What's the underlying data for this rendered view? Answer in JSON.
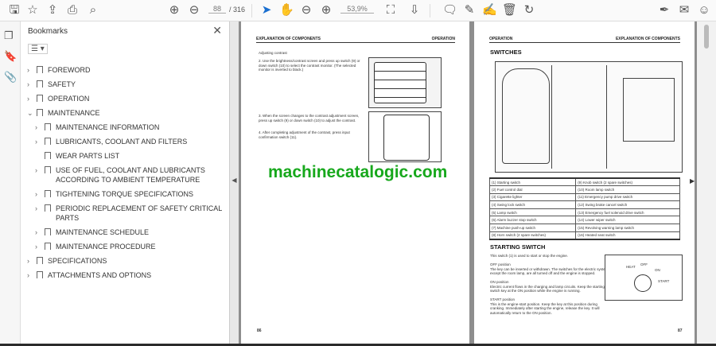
{
  "toolbar": {
    "current_page": "88",
    "total_pages": "/ 316",
    "zoom": "53,9%",
    "icons": [
      "save-icon",
      "star-icon",
      "upload-icon",
      "print-icon",
      "search-icon",
      "page-up-icon",
      "page-down-icon",
      "select-arrow-icon",
      "hand-icon",
      "zoom-out-icon",
      "zoom-in-icon",
      "fit-page-icon",
      "scroll-mode-icon",
      "comment-icon",
      "pen-icon",
      "sign-icon",
      "trash-icon",
      "rotate-icon",
      "fill-sign-icon",
      "mail-icon",
      "account-icon"
    ]
  },
  "sidebar": {
    "title": "Bookmarks",
    "items": [
      {
        "label": "FOREWORD",
        "level": 0,
        "expand": true
      },
      {
        "label": "SAFETY",
        "level": 0,
        "expand": true
      },
      {
        "label": "OPERATION",
        "level": 0,
        "expand": true
      },
      {
        "label": "MAINTENANCE",
        "level": 0,
        "expand": "open"
      },
      {
        "label": "MAINTENANCE INFORMATION",
        "level": 1,
        "expand": true
      },
      {
        "label": "LUBRICANTS, COOLANT AND FILTERS",
        "level": 1,
        "expand": true
      },
      {
        "label": "WEAR PARTS LIST",
        "level": 1,
        "expand": false
      },
      {
        "label": "USE OF FUEL, COOLANT AND LUBRICANTS ACCORDING TO AMBIENT TEMPERATURE",
        "level": 1,
        "expand": true
      },
      {
        "label": "TIGHTENING TORQUE SPECIFICATIONS",
        "level": 1,
        "expand": true
      },
      {
        "label": "PERIODIC REPLACEMENT OF SAFETY CRITICAL PARTS",
        "level": 1,
        "expand": true
      },
      {
        "label": "MAINTENANCE SCHEDULE",
        "level": 1,
        "expand": true
      },
      {
        "label": "MAINTENANCE PROCEDURE",
        "level": 1,
        "expand": true
      },
      {
        "label": "SPECIFICATIONS",
        "level": 0,
        "expand": true
      },
      {
        "label": "ATTACHMENTS AND OPTIONS",
        "level": 0,
        "expand": true
      }
    ]
  },
  "left_page": {
    "header_left": "EXPLANATION OF COMPONENTS",
    "header_right": "OPERATION",
    "bullet": "Adjusting contrast",
    "step2": "2.  Use the brightness/contrast screen and press up switch (9) or down switch (10) to select the contrast monitor. (The selected monitor is inverted to black.)",
    "step3": "3.  When the screen changes to the contrast adjustment screen, press up switch (9) or down switch (10) to adjust the contrast.",
    "step4": "4.  After completing adjustment of the contrast, press input confirmation switch (11).",
    "page_number": "86"
  },
  "watermark": "machinecatalogic.com",
  "right_page": {
    "header_left": "OPERATION",
    "header_right": "EXPLANATION OF COMPONENTS",
    "section": "SWITCHES",
    "table": [
      [
        "(1) Starting switch",
        "(9) Knob switch (2 spare switches)"
      ],
      [
        "(2) Fuel control dial",
        "(10) Room lamp switch"
      ],
      [
        "(3) Cigarette lighter",
        "(11) Emergency pump drive switch"
      ],
      [
        "(4) Swing lock switch",
        "(12) Swing brake cancel switch"
      ],
      [
        "(5) Lamp switch",
        "(13) Emergency fuel solenoid drive switch"
      ],
      [
        "(6) Alarm buzzer stop switch",
        "(14) Lower wiper switch"
      ],
      [
        "(7) Machine push-up switch",
        "(15) Revolving warning lamp switch"
      ],
      [
        "(8) Horn switch (2 spare switches)",
        "(16) Heated seat switch"
      ]
    ],
    "subsection": "STARTING  SWITCH",
    "intro": "This switch (1) is used to start or stop the engine.",
    "off_title": "OFF position",
    "off_text": "The key can be inserted or withdrawn. The switches for the electric system except the room lamp, are all turned off and the engine is stopped.",
    "on_title": "ON position",
    "on_text": "Electric current flows in the charging and lamp circuits. Keep the starting switch key at the ON position while the engine is running.",
    "start_title": "START position",
    "start_text": "This is the engine-start position. Keep the key at this position during cranking. Immediately after starting the engine, release the key. It will automatically return to the ON position.",
    "key_labels": [
      "HEAT",
      "OFF",
      "ON",
      "START"
    ],
    "page_number": "87"
  },
  "colors": {
    "watermark": "#17a81c",
    "doc_background": "#8e8e8e"
  }
}
